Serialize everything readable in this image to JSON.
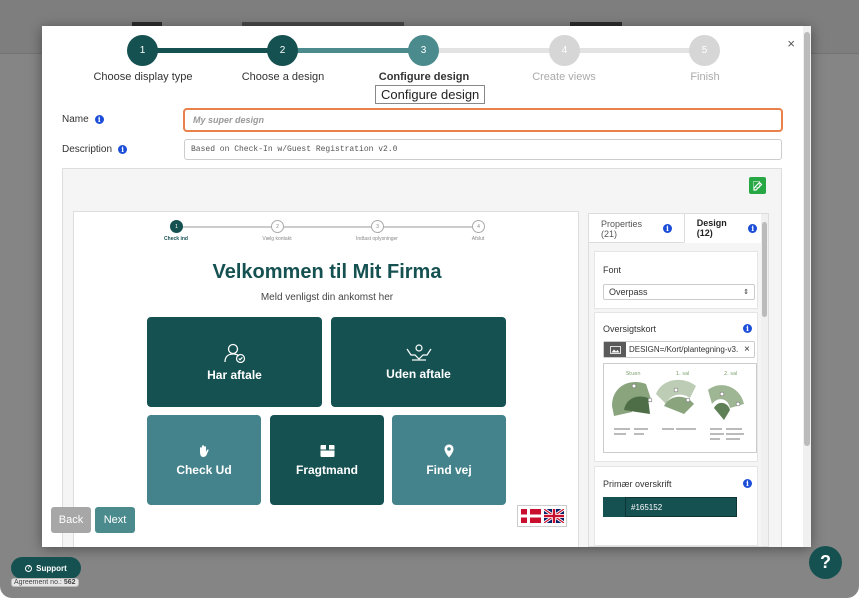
{
  "colors": {
    "brand": "#165152",
    "tile_light": "#45838c",
    "step_active": "#165152",
    "step_current": "#4c8b8d",
    "step_pending": "#d6d6d6"
  },
  "stepper": {
    "steps": [
      {
        "number": "1",
        "label": "Choose display type",
        "state": "done"
      },
      {
        "number": "2",
        "label": "Choose a design",
        "state": "done"
      },
      {
        "number": "3",
        "label": "Configure design",
        "state": "current"
      },
      {
        "number": "4",
        "label": "Create views",
        "state": "pending"
      },
      {
        "number": "5",
        "label": "Finish",
        "state": "pending"
      }
    ],
    "tooltip": "Configure design"
  },
  "close_label": "×",
  "form": {
    "name_label": "Name",
    "name_placeholder": "My super design",
    "description_label": "Description",
    "description_value": "Based on Check-In w/Guest Registration v2.0"
  },
  "preview": {
    "steps": [
      "Check ind",
      "Vælg kontakt",
      "Indtast oplysninger",
      "Afslut"
    ],
    "step_numbers": [
      "1",
      "2",
      "3",
      "4"
    ],
    "title": "Velkommen til Mit Firma",
    "subtitle": "Meld venligst din ankomst her",
    "tiles": {
      "har_aftale": "Har aftale",
      "uden_aftale": "Uden aftale",
      "check_ud": "Check Ud",
      "fragtmand": "Fragtmand",
      "find_vej": "Find vej"
    }
  },
  "nav": {
    "back": "Back",
    "next": "Next"
  },
  "panel": {
    "tab_properties": "Properties (21)",
    "tab_design": "Design (12)",
    "font_label": "Font",
    "font_value": "Overpass",
    "overview_label": "Oversigtskort",
    "overview_file": "DESIGN=/Kort/plantegning-v3.",
    "overview_remove": "×",
    "map_labels": [
      "Stuen",
      "1. sal",
      "2. sal"
    ],
    "primary_label": "Primær overskrift",
    "primary_value": "#165152"
  },
  "footer": {
    "support": "Support",
    "agreement_label": "Agreement no.:",
    "agreement_number": "562",
    "help": "?"
  }
}
